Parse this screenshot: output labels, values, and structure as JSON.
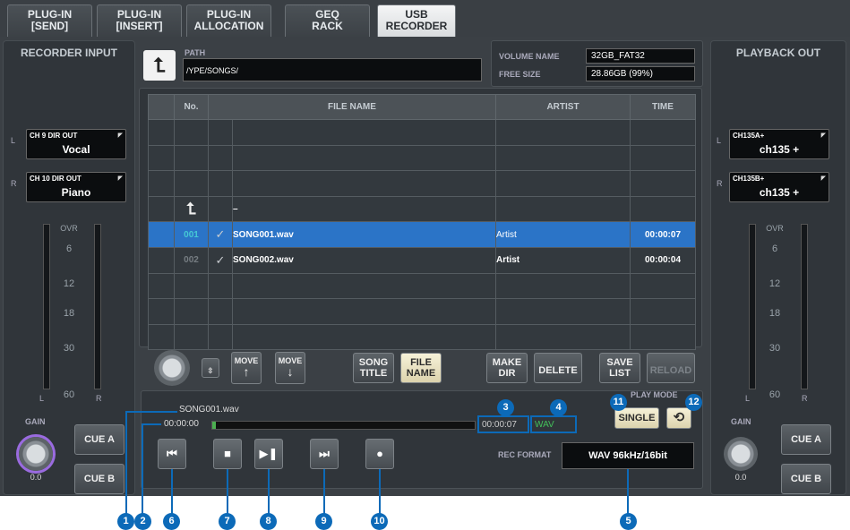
{
  "tabs": [
    {
      "label": "PLUG-IN\n[SEND]"
    },
    {
      "label": "PLUG-IN\n[INSERT]"
    },
    {
      "label": "PLUG-IN\nALLOCATION"
    },
    {
      "label": "GEQ\nRACK"
    },
    {
      "label": "USB\nRECORDER"
    }
  ],
  "recorder_input": {
    "title": "RECORDER INPUT",
    "l_label": "L",
    "r_label": "R",
    "patch_l": {
      "top": "CH 9 DIR OUT",
      "value": "Vocal"
    },
    "patch_r": {
      "top": "CH 10 DIR OUT",
      "value": "Piano"
    },
    "meter_scale": [
      "OVR",
      "6",
      "12",
      "18",
      "30",
      "60"
    ],
    "gain_label": "GAIN",
    "gain_value": "0.0",
    "cue_a": "CUE A",
    "cue_b": "CUE B"
  },
  "playback_out": {
    "title": "PLAYBACK OUT",
    "l_label": "L",
    "r_label": "R",
    "patch_l": {
      "top": "CH135A+",
      "value": "ch135 +"
    },
    "patch_r": {
      "top": "CH135B+",
      "value": "ch135 +"
    },
    "meter_scale": [
      "OVR",
      "6",
      "12",
      "18",
      "30",
      "60"
    ],
    "gain_label": "GAIN",
    "gain_value": "0.0",
    "cue_a": "CUE A",
    "cue_b": "CUE B"
  },
  "path": {
    "label": "PATH",
    "value": "/YPE/SONGS/",
    "up_icon": "up-arrow-icon"
  },
  "volume": {
    "name_label": "VOLUME NAME",
    "name_value": "32GB_FAT32",
    "free_label": "FREE SIZE",
    "free_value": "28.86GB (99%)"
  },
  "table": {
    "headers": [
      "No.",
      "",
      "FILE NAME",
      "ARTIST",
      "TIME"
    ],
    "rows": [
      {
        "no": "001",
        "file": "SONG001.wav",
        "artist": "Artist",
        "time": "00:00:07"
      },
      {
        "no": "002",
        "file": "SONG002.wav",
        "artist": "Artist",
        "time": "00:00:04"
      }
    ],
    "parent_dir": "–"
  },
  "toolbar": {
    "move_up": "MOVE",
    "move_down": "MOVE",
    "song_title": "SONG\nTITLE",
    "file_name": "FILE\nNAME",
    "make_dir": "MAKE\nDIR",
    "delete": "DELETE",
    "save_list": "SAVE\nLIST",
    "reload": "RELOAD"
  },
  "transport": {
    "filename": "SONG001.wav",
    "elapsed": "00:00:00",
    "remaining": "00:00:07",
    "format_badge": "WAV",
    "play_mode_label": "PLAY MODE",
    "single": "SINGLE",
    "rec_format_label": "REC FORMAT",
    "rec_format_value": "WAV 96kHz/16bit"
  },
  "callouts": [
    "1",
    "2",
    "3",
    "4",
    "5",
    "6",
    "7",
    "8",
    "9",
    "10",
    "11",
    "12"
  ],
  "colors": {
    "accent": "#0c6ab8",
    "selected_row": "#2b74c7",
    "number": "#45c9d4"
  }
}
